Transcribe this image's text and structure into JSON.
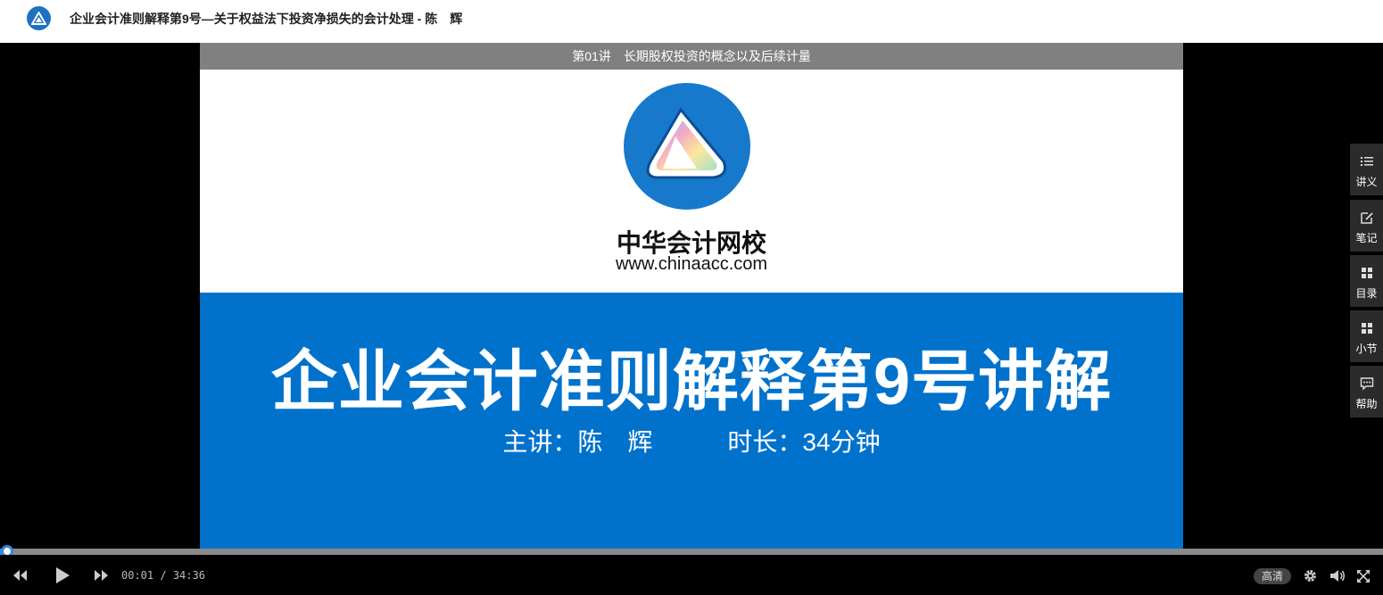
{
  "header": {
    "title": "企业会计准则解释第9号—关于权益法下投资净损失的会计处理 - 陈　辉"
  },
  "player": {
    "lesson_title": "第01讲　长期股权投资的概念以及后续计量",
    "slide": {
      "brand_cn": "中华会计网校",
      "brand_url": "www.chinaacc.com",
      "title": "企业会计准则解释第9号讲解",
      "meta": "主讲：陈　辉　　　时长：34分钟"
    },
    "current_time": "00:01",
    "time_sep": " / ",
    "duration": "34:36",
    "progress_fraction": 0.0005,
    "quality_label": "高清"
  },
  "side_panel": {
    "items": [
      {
        "label": "讲义",
        "icon": "list-icon"
      },
      {
        "label": "笔记",
        "icon": "edit-icon"
      },
      {
        "label": "目录",
        "icon": "grid-icon"
      },
      {
        "label": "小节",
        "icon": "grid-icon"
      },
      {
        "label": "帮助",
        "icon": "chat-icon"
      }
    ]
  },
  "colors": {
    "accent": "#2d8ae0",
    "slide_blue": "#0072cc",
    "side_panel_bg": "#2b2b2b"
  }
}
